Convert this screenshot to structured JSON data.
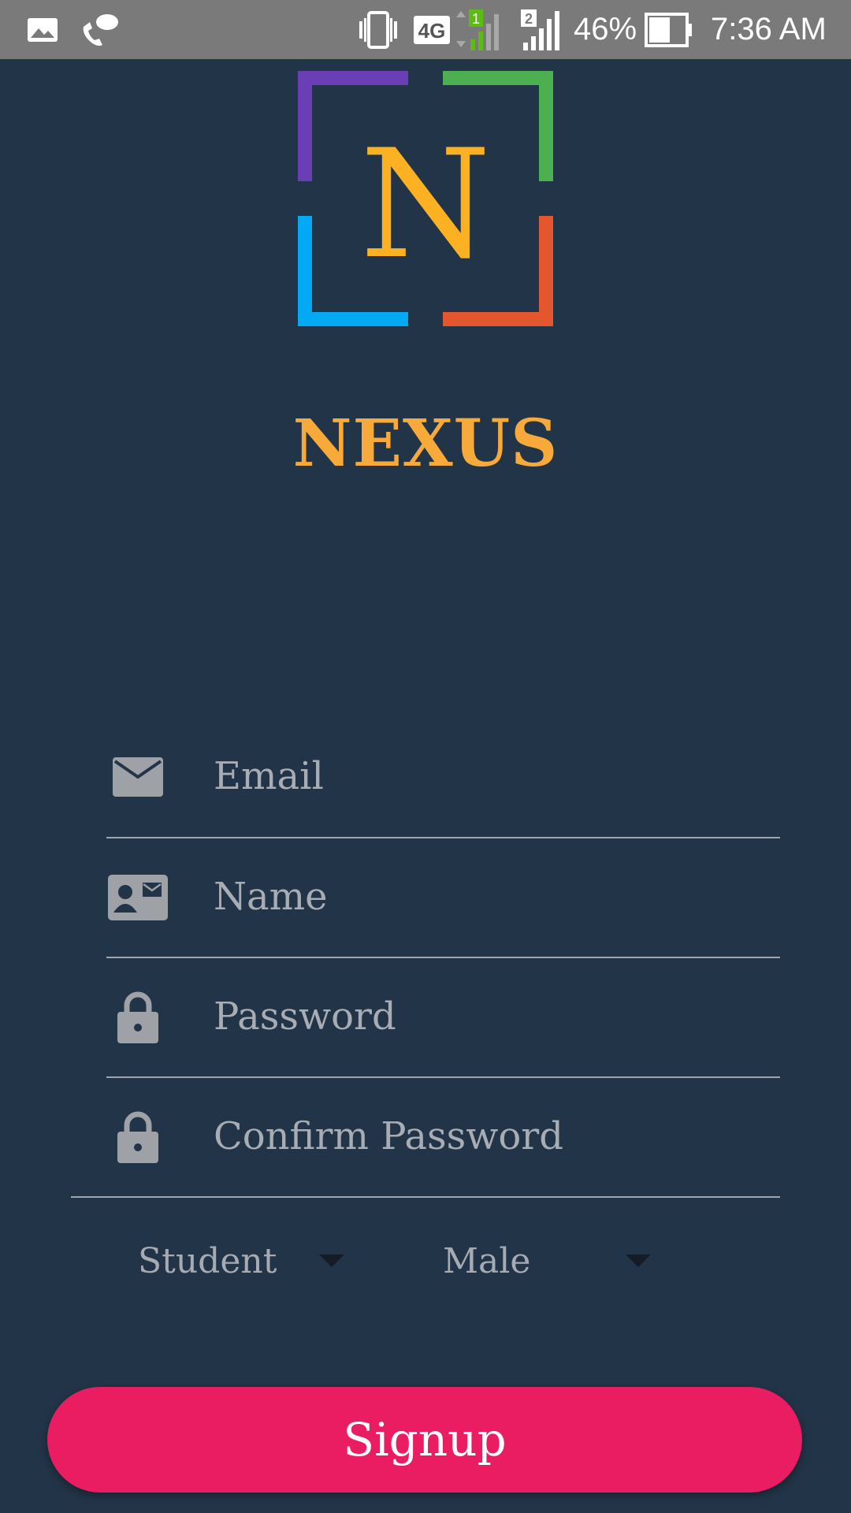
{
  "status_bar": {
    "battery_percent": "46%",
    "time": "7:36 AM",
    "network": "4G",
    "sim1_label": "1",
    "sim2_label": "2",
    "icons": [
      "gallery-icon",
      "call-chat-icon",
      "vibrate-icon",
      "network-4g-icon",
      "signal-sim1-icon",
      "signal-sim2-icon",
      "battery-icon"
    ]
  },
  "app": {
    "logo_letter": "N",
    "title": "NEXUS",
    "colors": {
      "background": "#223447",
      "title": "#f7a93a",
      "logo_purple": "#6a3fb5",
      "logo_green": "#4caf50",
      "logo_blue": "#03a9f4",
      "logo_orange": "#e4572e",
      "logo_letter": "#fcb122",
      "button": "#ea1d63"
    }
  },
  "form": {
    "email_placeholder": "Email",
    "name_placeholder": "Name",
    "password_placeholder": "Password",
    "confirm_password_placeholder": "Confirm Password",
    "role_selected": "Student",
    "gender_selected": "Male",
    "submit_label": "Signup"
  }
}
